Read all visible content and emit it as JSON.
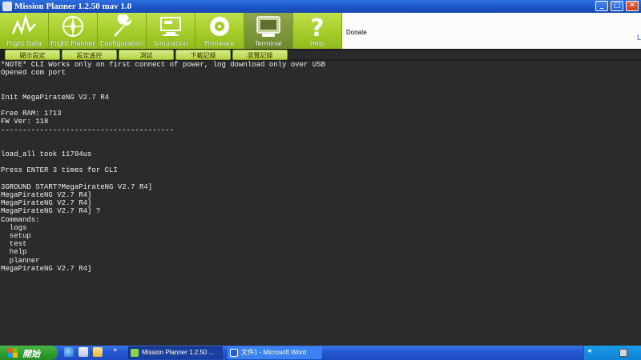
{
  "window": {
    "title": "Mission Planner 1.2.50 mav 1.0",
    "controls": [
      "_",
      "□",
      "✕"
    ]
  },
  "main_menu": {
    "items": [
      {
        "label": "Flight Data",
        "icon": "flight-data-icon"
      },
      {
        "label": "Flight Planner",
        "icon": "flight-planner-icon"
      },
      {
        "label": "Configuration",
        "icon": "configuration-icon"
      },
      {
        "label": "Simulation",
        "icon": "simulation-icon"
      },
      {
        "label": "Firmware",
        "icon": "firmware-icon"
      },
      {
        "label": "Terminal",
        "icon": "terminal-icon",
        "active": true
      },
      {
        "label": "Help",
        "icon": "help-icon"
      }
    ],
    "donate_label": "Donate",
    "edge_link": "L"
  },
  "sub_toolbar": {
    "buttons": [
      "顯示設定",
      "設定遙控",
      "測試",
      "下載記錄",
      "瀏覽記錄"
    ]
  },
  "terminal": {
    "lines": [
      "*NOTE* CLI Works only on first connect of power, log download only over USB",
      "Opened com port",
      "",
      "",
      "Init MegaPirateNG V2.7 R4",
      "",
      "Free RAM: 1713",
      "FW Ver: 118",
      "----------------------------------------",
      "",
      "",
      "load_all took 11784us",
      "",
      "Press ENTER 3 times for CLI",
      "",
      "3GROUND START?MegaPirateNG V2.7 R4]",
      "MegaPirateNG V2.7 R4]",
      "MegaPirateNG V2.7 R4]",
      "MegaPirateNG V2.7 R4] ?",
      "Commands:",
      "  logs",
      "  setup",
      "  test",
      "  help",
      "  planner",
      "MegaPirateNG V2.7 R4]"
    ]
  },
  "taskbar": {
    "start_label": "開始",
    "expand_glyph": "»",
    "tasks": [
      {
        "label": "Mission Planner 1.2.50 ...",
        "active": true
      },
      {
        "label": "文件1 - Microsoft Word",
        "active": false
      }
    ],
    "tray_arrow": "◂"
  },
  "colors": {
    "menu_green": "#a4cc2a",
    "terminal_bg": "#2b2b2b",
    "terminal_text": "#efefef",
    "titlebar_blue": "#1d56c9",
    "taskbar_blue": "#2458d4",
    "start_green": "#2f9a2f"
  }
}
